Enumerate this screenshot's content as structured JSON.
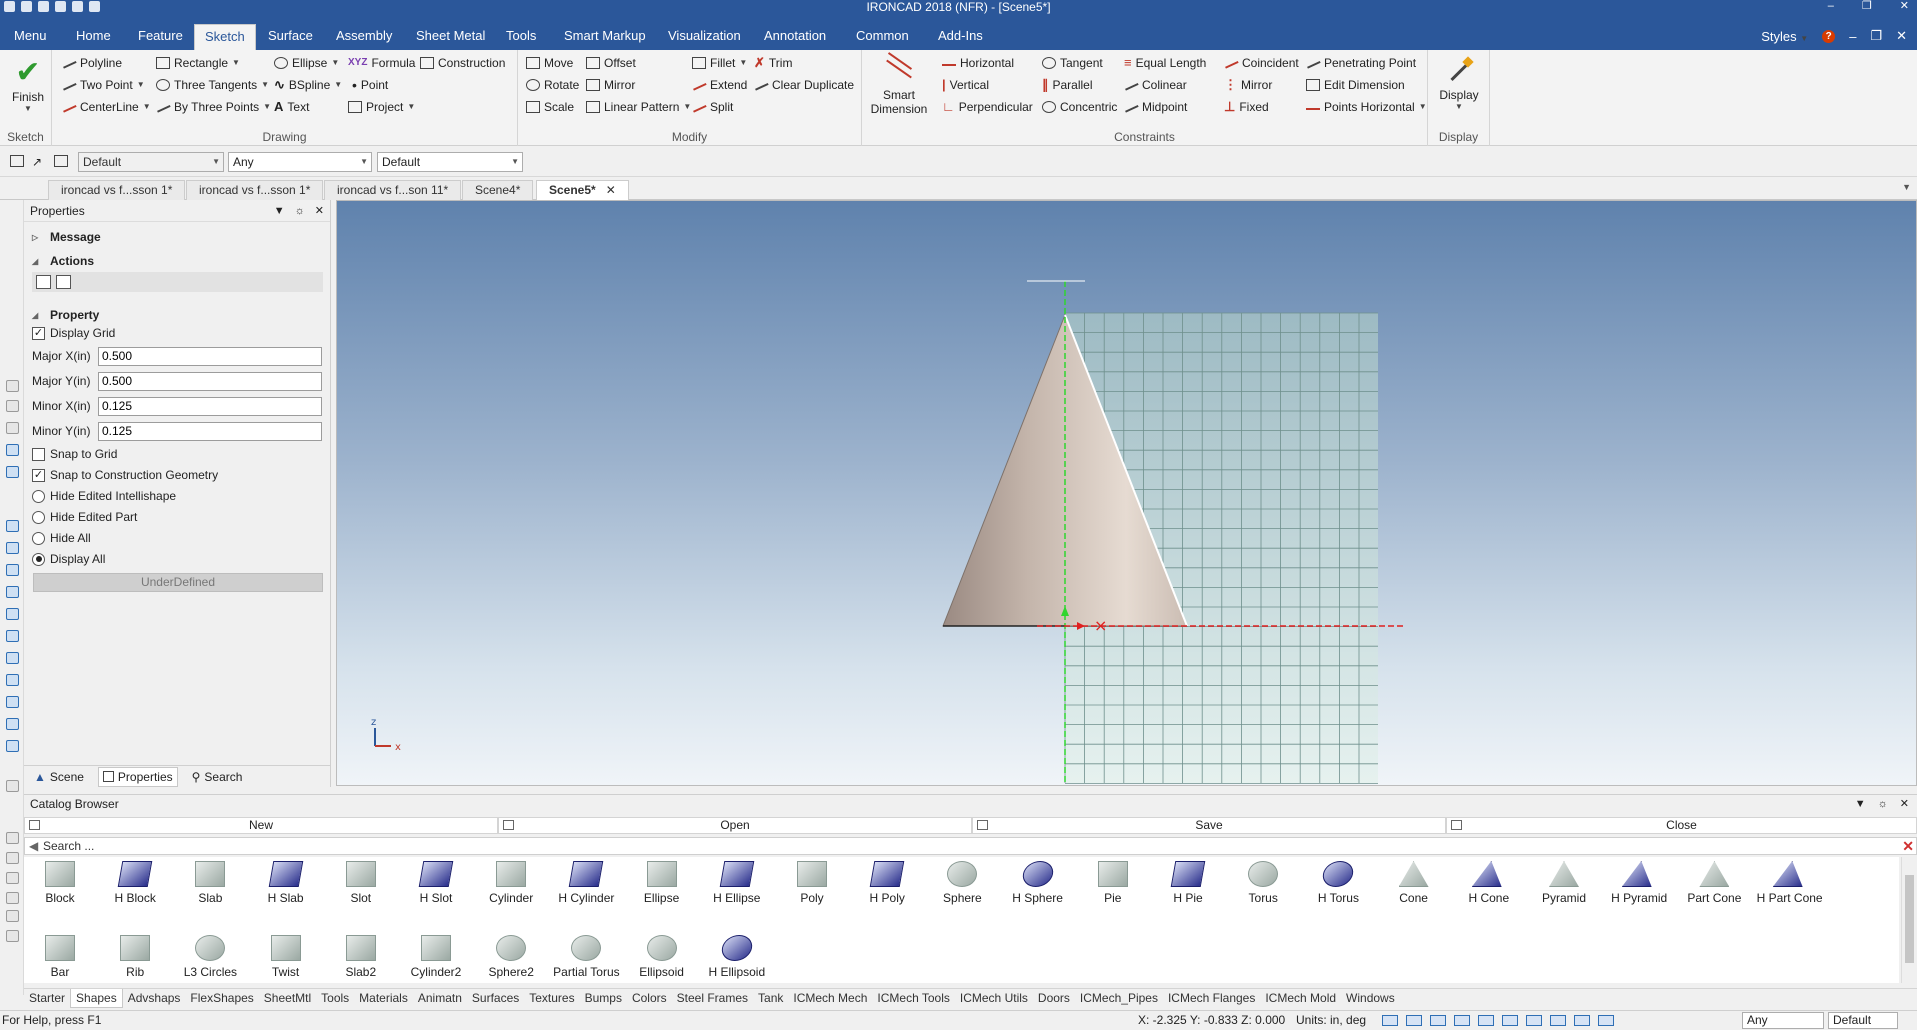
{
  "window": {
    "title": "IRONCAD 2018 (NFR) - [Scene5*]"
  },
  "menu": {
    "tabs": [
      "Menu",
      "Home",
      "Feature",
      "Sketch",
      "Surface",
      "Assembly",
      "Sheet Metal",
      "Tools",
      "Smart Markup",
      "Visualization",
      "Annotation",
      "Common",
      "Add-Ins"
    ],
    "active_tab": "Sketch",
    "styles_label": "Styles"
  },
  "ribbon": {
    "sketch_group": {
      "finish_label": "Finish",
      "group_label": "Sketch"
    },
    "drawing_group": {
      "group_label": "Drawing",
      "items": [
        "Polyline",
        "Rectangle",
        "Ellipse",
        "Formula",
        "Construction",
        "Two Point",
        "Three Tangents",
        "BSpline",
        "Point",
        "CenterLine",
        "By Three Points",
        "Text",
        "Project"
      ]
    },
    "modify_group": {
      "group_label": "Modify",
      "items": [
        "Move",
        "Offset",
        "Fillet",
        "Trim",
        "Rotate",
        "Mirror",
        "Extend",
        "Clear Duplicate",
        "Scale",
        "Linear Pattern",
        "Split"
      ]
    },
    "constraints_group": {
      "group_label": "Constraints",
      "smart_dimension": "Smart Dimension",
      "items": [
        "Horizontal",
        "Tangent",
        "Equal Length",
        "Coincident",
        "Penetrating Point",
        "Vertical",
        "Parallel",
        "Colinear",
        "Mirror",
        "Edit Dimension",
        "Perpendicular",
        "Concentric",
        "Midpoint",
        "Fixed",
        "Points Horizontal"
      ]
    },
    "display_group": {
      "display_label": "Display",
      "group_label": "Display"
    }
  },
  "format_bar": {
    "combo1": "Default",
    "combo2": "Any",
    "combo3": "Default"
  },
  "doc_tabs": [
    "ironcad vs f...sson 1*",
    "ironcad vs f...sson 1*",
    "ironcad vs f...son 11*",
    "Scene4*",
    "Scene5*"
  ],
  "properties": {
    "title": "Properties",
    "message_label": "Message",
    "actions_label": "Actions",
    "property_label": "Property",
    "display_grid": "Display Grid",
    "fields": [
      {
        "label": "Major X(in)",
        "value": "0.500"
      },
      {
        "label": "Major Y(in)",
        "value": "0.500"
      },
      {
        "label": "Minor X(in)",
        "value": "0.125"
      },
      {
        "label": "Minor Y(in)",
        "value": "0.125"
      }
    ],
    "snap_to_grid": "Snap to Grid",
    "snap_to_construction": "Snap to Construction Geometry",
    "radio_options": [
      "Hide Edited Intellishape",
      "Hide Edited Part",
      "Hide All",
      "Display All"
    ],
    "selected_radio": "Display All",
    "status": "UnderDefined",
    "bottom_tabs": [
      "Scene",
      "Properties",
      "Search"
    ],
    "active_bottom_tab": "Properties"
  },
  "viewport": {
    "axis_x": "x",
    "axis_z": "z"
  },
  "catalog": {
    "title": "Catalog Browser",
    "buttons": [
      "New",
      "Open",
      "Save",
      "Close"
    ],
    "search_placeholder": "Search ...",
    "shapes_row1": [
      "Block",
      "H Block",
      "Slab",
      "H Slab",
      "Slot",
      "H Slot",
      "Cylinder",
      "H Cylinder",
      "Ellipse",
      "H Ellipse",
      "Poly",
      "H Poly",
      "Sphere",
      "H Sphere",
      "Pie",
      "H Pie",
      "Torus",
      "H Torus",
      "Cone",
      "H Cone",
      "Pyramid",
      "H Pyramid",
      "Part Cone",
      "H Part Cone"
    ],
    "shapes_row2": [
      "Bar",
      "Rib",
      "L3 Circles",
      "Twist",
      "Slab2",
      "Cylinder2",
      "Sphere2",
      "Partial Torus",
      "Ellipsoid",
      "H Ellipsoid"
    ],
    "bottom_tabs": [
      "Starter",
      "Shapes",
      "Advshaps",
      "FlexShapes",
      "SheetMtl",
      "Tools",
      "Materials",
      "Animatn",
      "Surfaces",
      "Textures",
      "Bumps",
      "Colors",
      "Steel Frames",
      "Tank",
      "ICMech Mech",
      "ICMech Tools",
      "ICMech Utils",
      "Doors",
      "ICMech_Pipes",
      "ICMech Flanges",
      "ICMech Mold",
      "Windows"
    ],
    "active_bottom_tab": "Shapes"
  },
  "statusbar": {
    "help": "For Help, press F1",
    "coords": "X: -2.325 Y: -0.833 Z: 0.000",
    "units": "Units: in, deg",
    "combo1": "Any",
    "combo2": "Default"
  }
}
